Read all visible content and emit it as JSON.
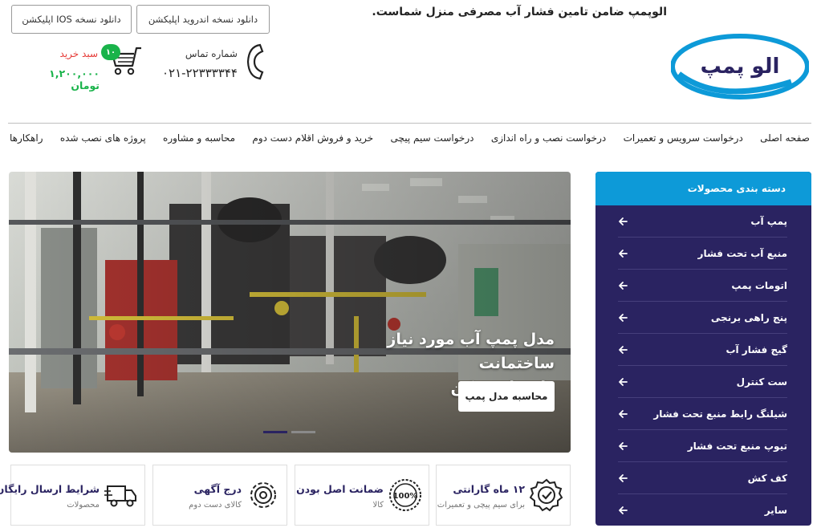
{
  "header": {
    "logo_text": "الو پمپ",
    "tagline": "الوپمپ ضامن تامین فشار آب مصرفی منزل شماست.",
    "download_android": "دانلود نسخه اندروید اپلیکشن",
    "download_ios": "دانلود نسخه IOS اپلیکشن",
    "contact_label": "شماره تماس",
    "contact_number": "۰۲۱-۲۲۳۳۳۳۴۴",
    "cart_label": "سبد خرید",
    "cart_count": "۱۰",
    "cart_total": "۱,۲۰۰,۰۰۰ تومان"
  },
  "nav": {
    "items": [
      "صفحه اصلی",
      "درخواست سرویس و تعمیرات",
      "درخواست نصب و راه اندازی",
      "درخواست سیم پیچی",
      "خرید و فروش اقلام دست دوم",
      "محاسبه و مشاوره",
      "پروژه های نصب شده",
      "راهکارها"
    ]
  },
  "sidebar": {
    "title": "دسته بندی محصولات",
    "items": [
      "پمپ آب",
      "منبع آب تحت فشار",
      "اتومات پمپ",
      "پنج راهی برنجی",
      "گیج فشار آب",
      "ست کنترل",
      "شیلنگ رابط منبع تحت فشار",
      "تیوپ منبع تحت فشار",
      "کف کش",
      "سایر"
    ]
  },
  "hero": {
    "title_line1": "مدل پمپ آب مورد نیاز ساختمانت",
    "title_line2": "را محاسبه کن",
    "button": "محاسبه مدل پمپ"
  },
  "features": [
    {
      "title": "۱۲ ماه گارانتی",
      "subtitle": "برای سیم پیچی و تعمیرات",
      "icon": "check-badge-icon"
    },
    {
      "title": "ضمانت اصل بودن",
      "subtitle": "کالا",
      "icon": "100-percent-seal-icon"
    },
    {
      "title": "درج آگهی",
      "subtitle": "کالای دست دوم",
      "icon": "gear-icon"
    },
    {
      "title": "شرایط ارسال رایگان",
      "subtitle": "محصولات",
      "icon": "delivery-truck-icon"
    }
  ],
  "colors": {
    "brand_navy": "#2a2361",
    "brand_blue": "#0d9ad8",
    "cart_green": "#19b34a",
    "cart_red": "#e53935"
  }
}
